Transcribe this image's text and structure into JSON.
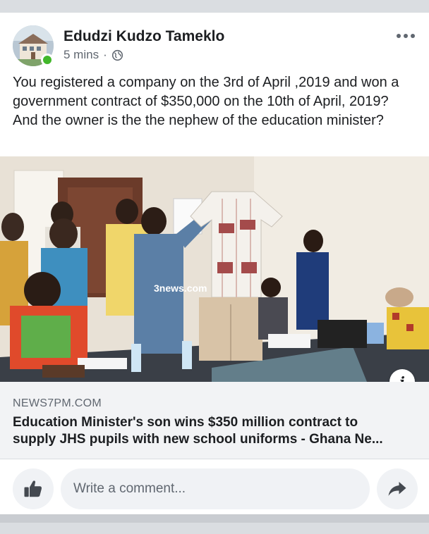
{
  "post": {
    "author": "Edudzi Kudzo Tameklo",
    "time": "5 mins",
    "separator": "·",
    "privacy_icon": "globe-icon",
    "more_icon": "more-options-icon",
    "text": "You registered a company on the 3rd of April ,2019 and won a government contract of $350,000  on the 10th of April, 2019? And the owner is the the nephew of the education minister?"
  },
  "link_preview": {
    "watermark": "3news.com",
    "info_icon": "info-icon",
    "info_glyph": "i",
    "domain": "NEWS7PM.COM",
    "title_line1": "Education Minister's son wins $350 million contract to",
    "title_line2": "supply JHS pupils with new school uniforms - Ghana Ne..."
  },
  "comment_bar": {
    "like_icon": "thumbs-up-icon",
    "placeholder": "Write a comment...",
    "share_icon": "share-arrow-icon"
  },
  "colors": {
    "online": "#42b72a",
    "text_secondary": "#606770",
    "bar_bg": "#f0f2f5",
    "divider": "#dadde1"
  }
}
